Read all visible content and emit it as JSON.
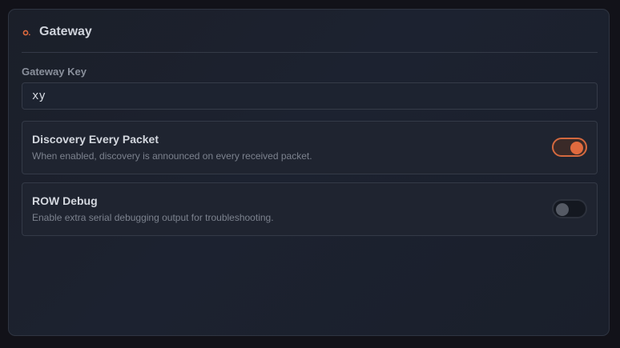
{
  "panel": {
    "title": "Gateway",
    "accent_color": "#e06a3e",
    "icon": "circle-dot-icon"
  },
  "gateway_key": {
    "label": "Gateway Key",
    "value": "xy"
  },
  "settings": [
    {
      "title": "Discovery Every Packet",
      "description": "When enabled, discovery is announced on every received packet.",
      "enabled": true
    },
    {
      "title": "ROW Debug",
      "description": "Enable extra serial debugging output for troubleshooting.",
      "enabled": false
    }
  ]
}
